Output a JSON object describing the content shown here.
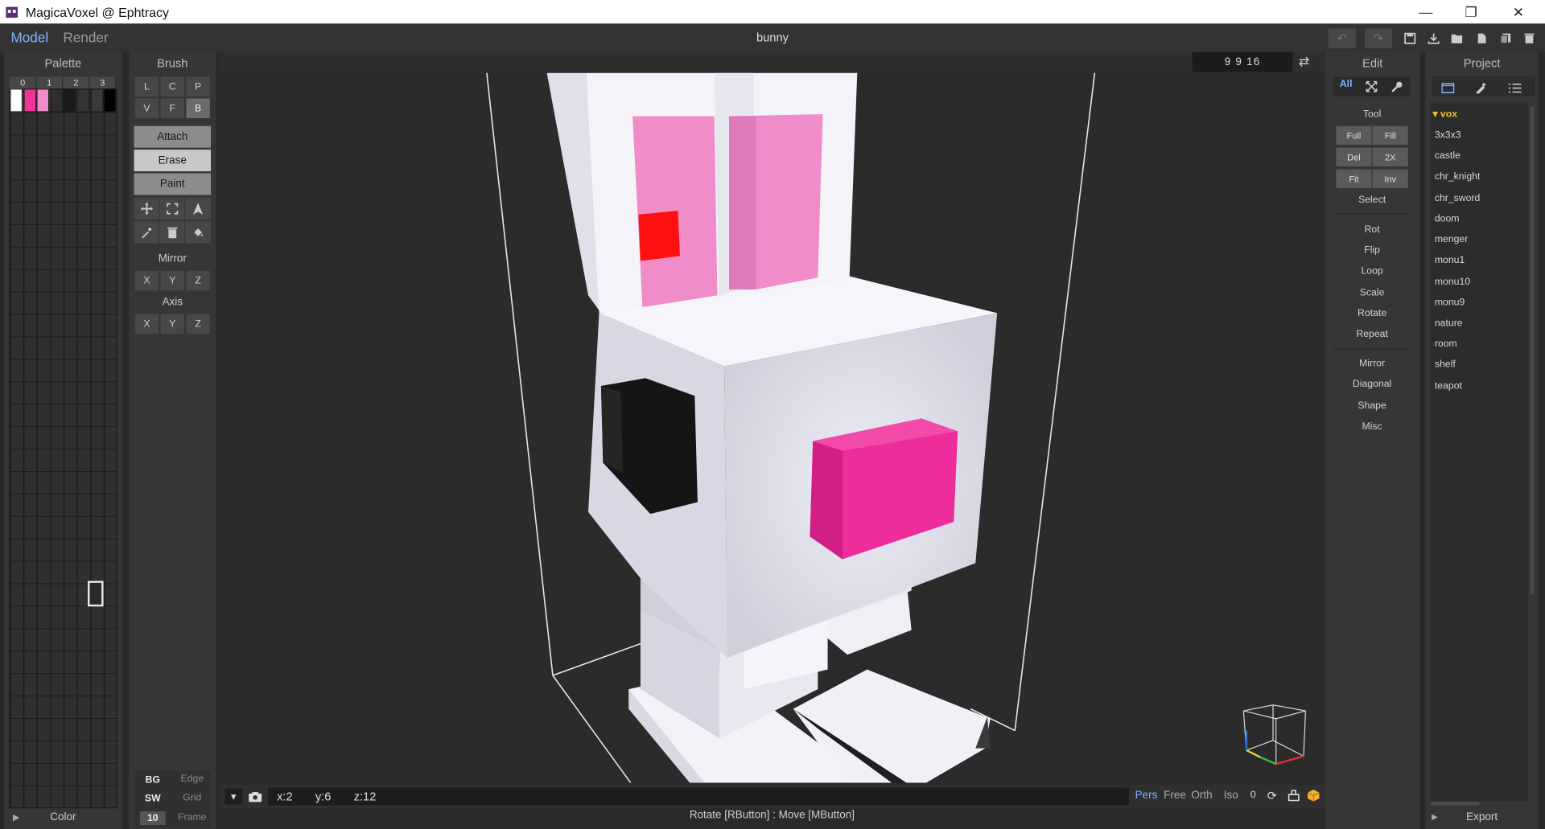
{
  "window": {
    "title": "MagicaVoxel @ Ephtracy"
  },
  "topbar": {
    "mode_tabs": [
      "Model",
      "Render"
    ],
    "active_mode": "Model",
    "document_title": "bunny"
  },
  "palette": {
    "title": "Palette",
    "column_tabs": [
      "0",
      "1",
      "2",
      "3"
    ],
    "colors": [
      "#ffffff",
      "#ee3399",
      "#f08cc8",
      "#2e2e2e",
      "#1a1a1a",
      "#333333",
      "#3a3a3a",
      "#000000"
    ],
    "footer_label": "Color"
  },
  "brush": {
    "title": "Brush",
    "row1": [
      "L",
      "C",
      "P"
    ],
    "row2": [
      "V",
      "F",
      "B"
    ],
    "modes": [
      "Attach",
      "Erase",
      "Paint"
    ],
    "mirror_title": "Mirror",
    "mirror": [
      "X",
      "Y",
      "Z"
    ],
    "axis_title": "Axis",
    "axis": [
      "X",
      "Y",
      "Z"
    ],
    "bottom": [
      {
        "key": "BG",
        "label": "Edge"
      },
      {
        "key": "SW",
        "label": "Grid"
      },
      {
        "key": "10",
        "label": "Frame"
      }
    ]
  },
  "viewport": {
    "dims": "9 9 16",
    "status": {
      "x": "x:2",
      "y": "y:6",
      "z": "z:12"
    },
    "view_modes": [
      "Pers",
      "Free",
      "Orth",
      "Iso"
    ],
    "active_view": "Pers",
    "view_counter": "0",
    "hint": "Rotate [RButton] : Move [MButton]"
  },
  "edit": {
    "title": "Edit",
    "filter_all": "All",
    "tool_title": "Tool",
    "tool_buttons": [
      "Full",
      "Fill",
      "Del",
      "2X",
      "Fit",
      "Inv"
    ],
    "select_label": "Select",
    "ops": [
      "Rot",
      "Flip",
      "Loop",
      "Scale",
      "Rotate",
      "Repeat"
    ],
    "ops2": [
      "Mirror",
      "Diagonal",
      "Shape",
      "Misc"
    ]
  },
  "project": {
    "title": "Project",
    "folder": "vox",
    "items": [
      "3x3x3",
      "castle",
      "chr_knight",
      "chr_sword",
      "doom",
      "menger",
      "monu1",
      "monu10",
      "monu9",
      "nature",
      "room",
      "shelf",
      "teapot"
    ],
    "export_label": "Export"
  },
  "colors": {
    "accent": "#7fb3ff",
    "folder_accent": "#f0c030",
    "bunny_pink": "#ee2d9c",
    "ear_pink": "#f08cc8"
  }
}
